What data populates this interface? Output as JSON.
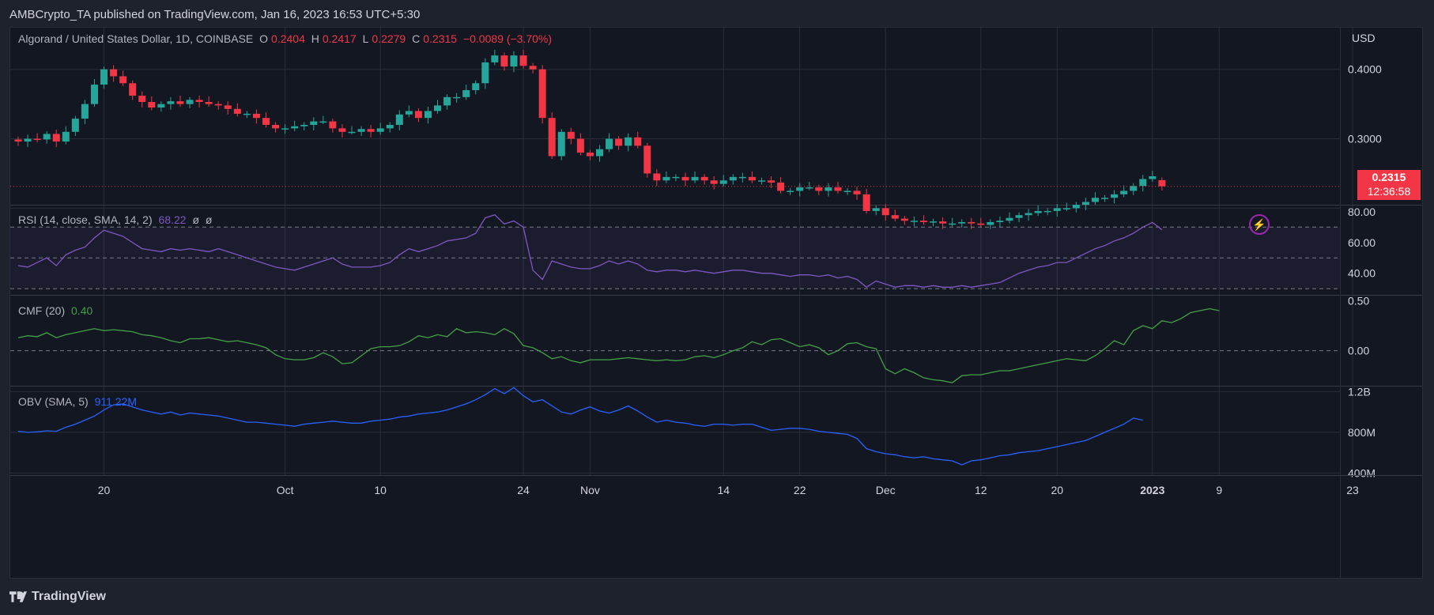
{
  "header": {
    "text": "AMBCrypto_TA published on TradingView.com, Jan 16, 2023 16:53 UTC+5:30"
  },
  "footer": {
    "brand": "TradingView"
  },
  "colors": {
    "up": "#26a69a",
    "down": "#f23645",
    "rsi": "#7e57c2",
    "cmf": "#43a047",
    "obv": "#2962ff",
    "bg": "#131722",
    "grid": "#2a2e39",
    "axis_text": "#d1d4dc"
  },
  "main": {
    "symbol": "Algorand / United States Dollar, 1D, COINBASE",
    "o_label": "O",
    "o": "0.2404",
    "h_label": "H",
    "h": "0.2417",
    "l_label": "L",
    "l": "0.2279",
    "c_label": "C",
    "c": "0.2315",
    "change": "−0.0089 (−3.70%)",
    "currency": "USD",
    "last_price": "0.2315",
    "countdown": "12:36:58"
  },
  "rsi": {
    "label": "RSI (14, close, SMA, 14, 2)",
    "value": "68.22",
    "n1": "ø",
    "n2": "ø"
  },
  "cmf": {
    "label": "CMF (20)",
    "value": "0.40"
  },
  "obv": {
    "label": "OBV (SMA, 5)",
    "value": "911.22M"
  },
  "chart_data": [
    {
      "type": "candlestick",
      "title": "Algorand / United States Dollar, 1D, COINBASE",
      "y_ticks": [
        "0.4000",
        "0.3000"
      ],
      "x_ticks": [
        "20",
        "Oct",
        "10",
        "24",
        "Nov",
        "14",
        "22",
        "Dec",
        "12",
        "20",
        "2023",
        "9",
        "23"
      ],
      "ylim": [
        0.2,
        0.46
      ],
      "close": [
        0.296,
        0.3,
        0.299,
        0.307,
        0.296,
        0.31,
        0.329,
        0.35,
        0.378,
        0.4,
        0.39,
        0.38,
        0.362,
        0.353,
        0.345,
        0.35,
        0.354,
        0.35,
        0.356,
        0.353,
        0.35,
        0.348,
        0.343,
        0.336,
        0.336,
        0.33,
        0.32,
        0.315,
        0.315,
        0.318,
        0.32,
        0.325,
        0.325,
        0.315,
        0.31,
        0.31,
        0.314,
        0.31,
        0.315,
        0.32,
        0.335,
        0.34,
        0.33,
        0.34,
        0.348,
        0.36,
        0.36,
        0.37,
        0.38,
        0.41,
        0.42,
        0.404,
        0.42,
        0.405,
        0.4,
        0.33,
        0.275,
        0.31,
        0.3,
        0.28,
        0.275,
        0.285,
        0.3,
        0.29,
        0.302,
        0.29,
        0.25,
        0.24,
        0.245,
        0.245,
        0.24,
        0.245,
        0.24,
        0.235,
        0.24,
        0.245,
        0.245,
        0.24,
        0.24,
        0.237,
        0.225,
        0.225,
        0.23,
        0.23,
        0.225,
        0.23,
        0.225,
        0.225,
        0.22,
        0.196,
        0.2,
        0.19,
        0.185,
        0.182,
        0.182,
        0.18,
        0.181,
        0.178,
        0.178,
        0.18,
        0.178,
        0.176,
        0.18,
        0.182,
        0.186,
        0.19,
        0.193,
        0.196,
        0.196,
        0.2,
        0.2,
        0.205,
        0.209,
        0.215,
        0.215,
        0.22,
        0.225,
        0.232,
        0.242,
        0.246,
        0.2315
      ],
      "open": [
        0.299,
        0.296,
        0.3,
        0.299,
        0.307,
        0.296,
        0.31,
        0.329,
        0.35,
        0.378,
        0.4,
        0.39,
        0.38,
        0.362,
        0.353,
        0.345,
        0.35,
        0.354,
        0.35,
        0.356,
        0.353,
        0.35,
        0.348,
        0.343,
        0.336,
        0.336,
        0.33,
        0.32,
        0.315,
        0.315,
        0.318,
        0.32,
        0.325,
        0.325,
        0.315,
        0.31,
        0.31,
        0.314,
        0.31,
        0.315,
        0.32,
        0.335,
        0.34,
        0.33,
        0.34,
        0.348,
        0.36,
        0.36,
        0.37,
        0.38,
        0.41,
        0.42,
        0.404,
        0.42,
        0.405,
        0.4,
        0.33,
        0.275,
        0.31,
        0.3,
        0.28,
        0.275,
        0.285,
        0.3,
        0.29,
        0.302,
        0.29,
        0.25,
        0.24,
        0.245,
        0.245,
        0.24,
        0.245,
        0.24,
        0.235,
        0.24,
        0.245,
        0.245,
        0.24,
        0.24,
        0.237,
        0.225,
        0.225,
        0.23,
        0.23,
        0.225,
        0.23,
        0.225,
        0.225,
        0.22,
        0.196,
        0.2,
        0.19,
        0.185,
        0.182,
        0.182,
        0.18,
        0.181,
        0.178,
        0.178,
        0.18,
        0.178,
        0.176,
        0.18,
        0.182,
        0.186,
        0.19,
        0.193,
        0.196,
        0.196,
        0.2,
        0.2,
        0.205,
        0.209,
        0.215,
        0.215,
        0.22,
        0.225,
        0.232,
        0.242,
        0.2404
      ]
    },
    {
      "type": "line",
      "title": "RSI (14, close, SMA, 14, 2)",
      "y_ticks": [
        "80.00",
        "60.00",
        "40.00"
      ],
      "ylim": [
        30,
        85
      ],
      "bands": [
        70,
        50,
        30
      ],
      "values": [
        45,
        44,
        47,
        50,
        45,
        52,
        55,
        57,
        63,
        68,
        66,
        64,
        60,
        56,
        55,
        54,
        56,
        55,
        56,
        55,
        54,
        56,
        54,
        52,
        50,
        48,
        46,
        44,
        43,
        42,
        44,
        46,
        48,
        50,
        46,
        44,
        44,
        44,
        45,
        47,
        52,
        56,
        54,
        56,
        58,
        61,
        62,
        63,
        66,
        76,
        78,
        72,
        74,
        70,
        42,
        36,
        48,
        46,
        44,
        43,
        43,
        45,
        48,
        46,
        48,
        46,
        42,
        41,
        42,
        42,
        41,
        42,
        41,
        40,
        41,
        42,
        42,
        41,
        40,
        40,
        39,
        38,
        39,
        39,
        38,
        39,
        37,
        38,
        36,
        31,
        35,
        33,
        31,
        32,
        32,
        31,
        32,
        31,
        31,
        32,
        31,
        32,
        33,
        34,
        37,
        40,
        42,
        44,
        45,
        47,
        47,
        50,
        53,
        56,
        58,
        61,
        63,
        66,
        70,
        73,
        68.22
      ]
    },
    {
      "type": "line",
      "title": "CMF (20)",
      "y_ticks": [
        "0.50",
        "0.00"
      ],
      "ylim": [
        -0.35,
        0.55
      ],
      "values": [
        0.13,
        0.15,
        0.14,
        0.18,
        0.13,
        0.16,
        0.18,
        0.2,
        0.22,
        0.2,
        0.21,
        0.2,
        0.19,
        0.16,
        0.15,
        0.13,
        0.1,
        0.08,
        0.12,
        0.12,
        0.13,
        0.11,
        0.09,
        0.1,
        0.08,
        0.06,
        0.03,
        -0.04,
        -0.08,
        -0.09,
        -0.09,
        -0.07,
        -0.02,
        -0.06,
        -0.13,
        -0.12,
        -0.05,
        0.02,
        0.04,
        0.04,
        0.05,
        0.09,
        0.15,
        0.13,
        0.16,
        0.14,
        0.22,
        0.18,
        0.19,
        0.18,
        0.16,
        0.22,
        0.17,
        0.05,
        0.03,
        -0.02,
        -0.08,
        -0.06,
        -0.1,
        -0.12,
        -0.09,
        -0.09,
        -0.09,
        -0.08,
        -0.07,
        -0.08,
        -0.09,
        -0.1,
        -0.09,
        -0.1,
        -0.09,
        -0.06,
        -0.05,
        -0.07,
        -0.04,
        0.0,
        0.03,
        0.09,
        0.06,
        0.11,
        0.12,
        0.08,
        0.04,
        0.06,
        0.03,
        -0.04,
        0.0,
        0.07,
        0.08,
        0.04,
        0.02,
        -0.18,
        -0.23,
        -0.18,
        -0.22,
        -0.27,
        -0.29,
        -0.3,
        -0.32,
        -0.25,
        -0.24,
        -0.24,
        -0.22,
        -0.2,
        -0.2,
        -0.18,
        -0.16,
        -0.14,
        -0.12,
        -0.1,
        -0.08,
        -0.09,
        -0.1,
        -0.05,
        0.02,
        0.1,
        0.06,
        0.2,
        0.25,
        0.22,
        0.3,
        0.28,
        0.32,
        0.38,
        0.4,
        0.42,
        0.4
      ]
    },
    {
      "type": "line",
      "title": "OBV (SMA, 5)",
      "y_ticks": [
        "1.2B",
        "800M",
        "400M"
      ],
      "ylim": [
        380,
        1250
      ],
      "values": [
        810,
        800,
        805,
        815,
        810,
        850,
        880,
        920,
        960,
        1020,
        1070,
        1080,
        1050,
        1020,
        1000,
        980,
        1000,
        970,
        990,
        980,
        970,
        960,
        940,
        920,
        900,
        900,
        890,
        880,
        870,
        860,
        880,
        890,
        900,
        910,
        900,
        890,
        890,
        910,
        920,
        930,
        950,
        960,
        980,
        990,
        1000,
        1020,
        1050,
        1080,
        1120,
        1170,
        1230,
        1180,
        1240,
        1160,
        1100,
        1120,
        1060,
        1000,
        980,
        1020,
        1050,
        1010,
        990,
        1020,
        1060,
        1010,
        950,
        900,
        920,
        900,
        890,
        870,
        860,
        880,
        880,
        870,
        880,
        880,
        850,
        820,
        830,
        840,
        840,
        830,
        810,
        800,
        790,
        780,
        740,
        640,
        610,
        590,
        580,
        560,
        550,
        560,
        540,
        530,
        520,
        480,
        520,
        530,
        550,
        570,
        580,
        600,
        610,
        620,
        640,
        660,
        680,
        700,
        720,
        760,
        800,
        840,
        880,
        940,
        920
      ]
    }
  ]
}
